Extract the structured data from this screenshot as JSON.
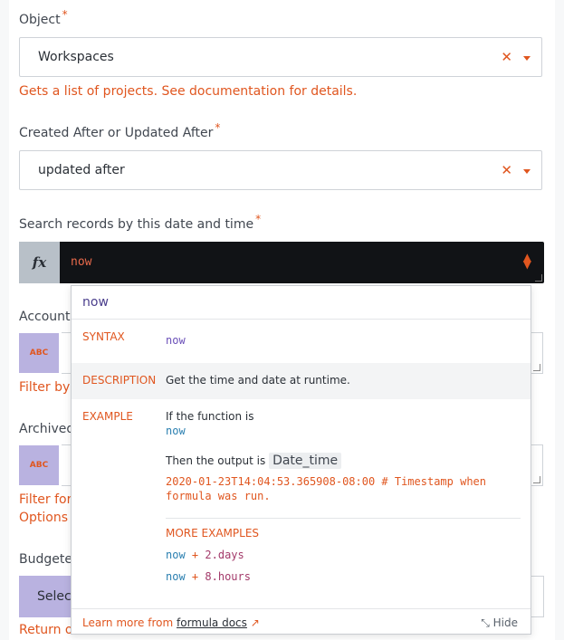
{
  "object": {
    "label": "Object",
    "required_mark": "*",
    "value": "Workspaces",
    "hint": "Gets a list of projects. See documentation for details."
  },
  "created_updated": {
    "label": "Created After or Updated After",
    "required_mark": "*",
    "value": "updated after"
  },
  "search_records": {
    "label": "Search records by this date and time",
    "required_mark": "*",
    "fx": "fx",
    "formula_value": "now"
  },
  "account": {
    "label_partial": "Account",
    "pill": "ABC",
    "hint_partial": "Filter by c"
  },
  "archived": {
    "label_partial": "Archived",
    "pill": "ABC",
    "hint_partial_1": "Filter for c",
    "hint_partial_2": "Options a"
  },
  "budgeted": {
    "label_partial": "Budgetec",
    "select_partial": "Selec",
    "hint_partial": "Return o"
  },
  "popup": {
    "query": "now",
    "syntax_label": "SYNTAX",
    "syntax_value": "now",
    "description_label": "DESCRIPTION",
    "description_value": "Get the time and date at runtime.",
    "example_label": "EXAMPLE",
    "example_intro": "If the function is",
    "example_code": "now",
    "example_output_prefix": "Then the output is",
    "example_output_tag": "Date_time",
    "example_result_line1": "2020-01-23T14:04:53.365908-08:00 # Timestamp when",
    "example_result_line2": "formula was run.",
    "more_examples_label": "MORE EXAMPLES",
    "more_examples": [
      {
        "code": "now",
        "op": "+",
        "arg": "2.days"
      },
      {
        "code": "now",
        "op": "+",
        "arg": "8.hours"
      }
    ],
    "footer_prefix": "Learn more from",
    "footer_link": "formula docs",
    "hide_label": "Hide"
  },
  "colors": {
    "accent": "#e0561f",
    "formula_bg": "#111316",
    "pill_bg": "#b9b2e0"
  }
}
